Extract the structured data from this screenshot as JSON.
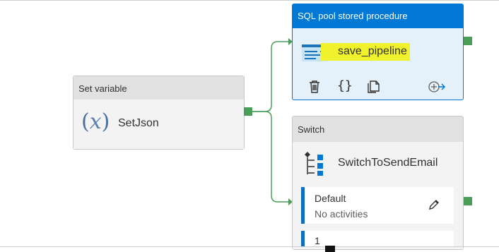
{
  "activities": {
    "set_variable": {
      "type_label": "Set variable",
      "name": "SetJson",
      "icon": "fx-variable-icon"
    },
    "sql_pool": {
      "type_label": "SQL pool stored procedure",
      "name": "save_pipeline",
      "icon": "stored-procedure-icon",
      "actions": [
        "delete-icon",
        "code-icon",
        "copy-icon",
        "add-output-icon"
      ]
    },
    "switch": {
      "type_label": "Switch",
      "name": "SwitchToSendEmail",
      "icon": "switch-icon",
      "cases": [
        {
          "label": "Default",
          "sub": "No activities"
        },
        {
          "label": "1",
          "sub": ""
        }
      ]
    }
  },
  "colors": {
    "accent": "#0078d4",
    "success_port": "#4a9e5a",
    "highlight": "#f0f22b"
  }
}
